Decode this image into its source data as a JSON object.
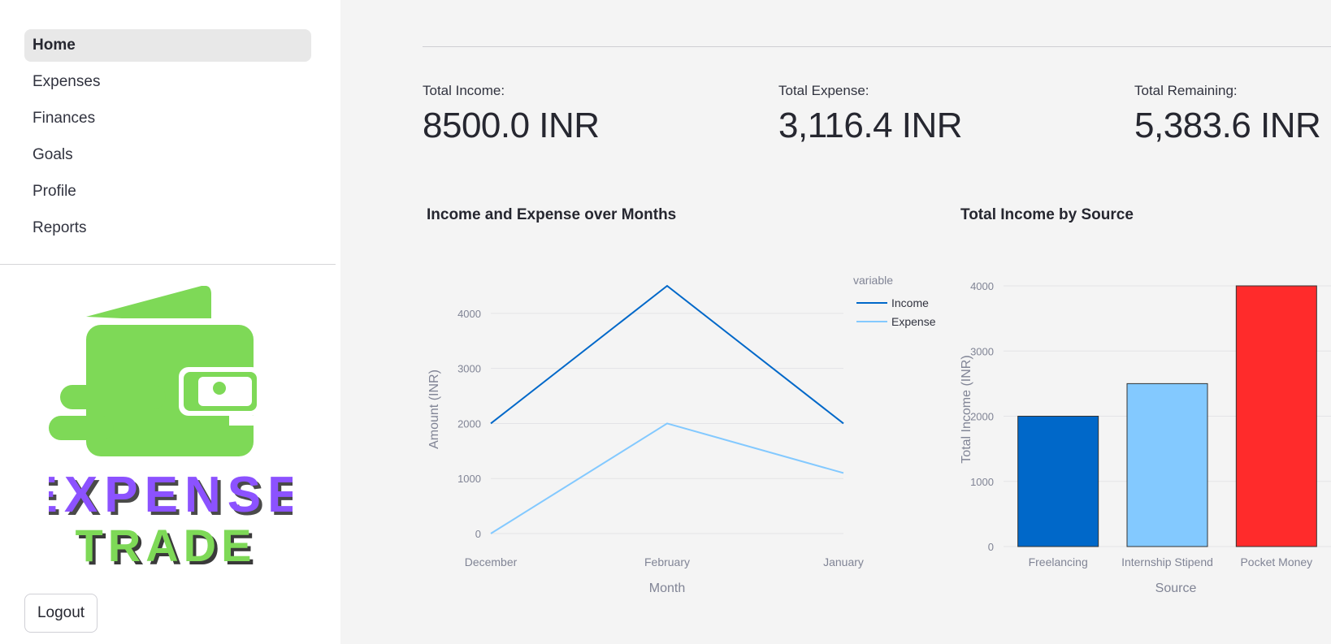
{
  "sidebar": {
    "items": [
      {
        "label": "Home",
        "active": true
      },
      {
        "label": "Expenses",
        "active": false
      },
      {
        "label": "Finances",
        "active": false
      },
      {
        "label": "Goals",
        "active": false
      },
      {
        "label": "Profile",
        "active": false
      },
      {
        "label": "Reports",
        "active": false
      }
    ],
    "logo": {
      "word1": "EXPENSE",
      "word2": "TRADE",
      "green": "#7ed957",
      "purple": "#8c52ff"
    },
    "logout_label": "Logout"
  },
  "metrics": [
    {
      "label": "Total Income:",
      "value": "8500.0 INR"
    },
    {
      "label": "Total Expense:",
      "value": "3,116.4 INR"
    },
    {
      "label": "Total Remaining:",
      "value": "5,383.6 INR"
    }
  ],
  "colors": {
    "income": "#0068c9",
    "expense": "#83c9ff",
    "pocket": "#ff2b2b"
  },
  "chart_data": [
    {
      "type": "line",
      "title": "Income and Expense over Months",
      "categories": [
        "December",
        "February",
        "January"
      ],
      "series": [
        {
          "name": "Income",
          "values": [
            2000,
            4500,
            2000
          ]
        },
        {
          "name": "Expense",
          "values": [
            0,
            2000,
            1100
          ]
        }
      ],
      "xlabel": "Month",
      "ylabel": "Amount (INR)",
      "ylim": [
        0,
        4500
      ],
      "yticks": [
        0,
        1000,
        2000,
        3000,
        4000
      ],
      "legend_title": "variable",
      "legend_position": "top-right",
      "grid": true
    },
    {
      "type": "bar",
      "title": "Total Income by Source",
      "categories": [
        "Freelancing",
        "Internship Stipend",
        "Pocket Money"
      ],
      "values": [
        2000,
        2500,
        4000
      ],
      "xlabel": "Source",
      "ylabel": "Total Income (INR)",
      "ylim": [
        0,
        4000
      ],
      "yticks": [
        0,
        1000,
        2000,
        3000,
        4000
      ],
      "grid": true
    }
  ]
}
